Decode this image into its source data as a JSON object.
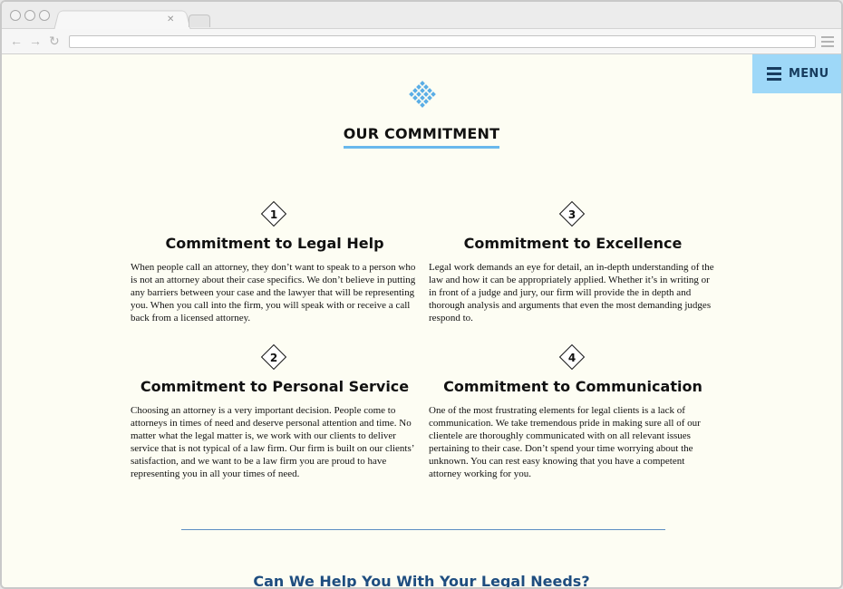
{
  "menu": {
    "label": "MENU"
  },
  "section": {
    "heading": "OUR COMMITMENT"
  },
  "commitments": [
    {
      "number": "1",
      "title": "Commitment to Legal Help",
      "body": "When people call an attorney, they don’t want to speak to a person who is not an attorney about their case specifics. We don’t believe in putting any barriers between your case and the lawyer that will be representing you.  When you call into the firm, you will speak with or receive a call back from a licensed attorney."
    },
    {
      "number": "2",
      "title": "Commitment to Personal Service",
      "body": "Choosing an attorney is a very important decision. People come to attorneys in times of need and deserve personal attention and time.  No matter what the legal matter is, we work with our clients to deliver service that is not typical of a law firm.  Our firm is built on our clients’ satisfaction, and we want to be a law firm you are proud to have representing you in all your times of need."
    },
    {
      "number": "3",
      "title": "Commitment to Excellence",
      "body": "Legal work demands an eye for detail, an in-depth understanding of the law and how it can be appropriately applied.  Whether it’s in writing or in front of a judge and jury, our firm will provide the in depth and thorough analysis and arguments that even the most demanding judges respond to."
    },
    {
      "number": "4",
      "title": "Commitment to Communication",
      "body": "One of the most frustrating elements for legal clients is a lack of communication.  We take tremendous pride in making sure all of our clientele are thoroughly communicated with on all relevant issues pertaining to their case.  Don’t spend your time worrying about the unknown.  You can rest easy knowing that you have a competent attorney working for you."
    }
  ],
  "cta": {
    "text": "Can We Help You With Your Legal Needs?"
  },
  "colors": {
    "accent": "#69b8ec",
    "menu_bg": "#9ed8f8",
    "navy": "#173c5e",
    "page_bg": "#fdfdf3"
  }
}
